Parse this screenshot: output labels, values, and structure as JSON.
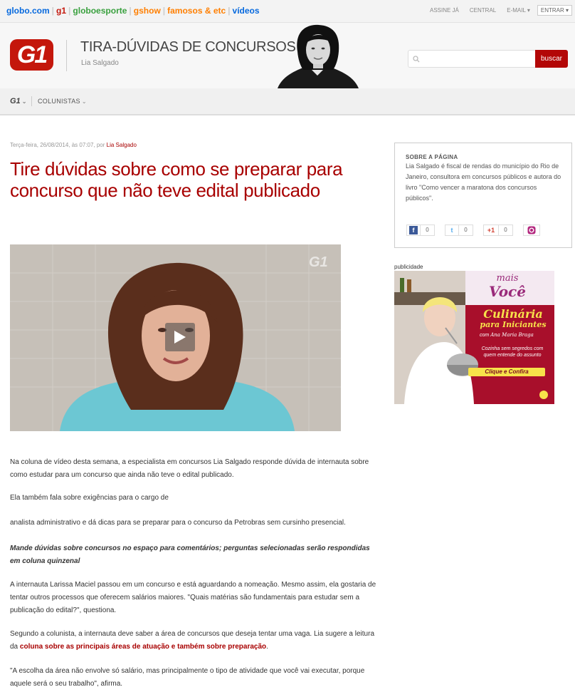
{
  "topbar": {
    "links": [
      {
        "label": "globo.com",
        "color": "#0669de"
      },
      {
        "label": "g1",
        "color": "#c4170c"
      },
      {
        "label": "globoesporte",
        "color": "#39a03e"
      },
      {
        "label": "gshow",
        "color": "#ff7f00"
      },
      {
        "label": "famosos & etc",
        "color": "#ff7f00"
      },
      {
        "label": "vídeos",
        "color": "#0669de"
      }
    ],
    "right": {
      "assine": "ASSINE JÁ",
      "central": "CENTRAL",
      "email": "E-MAIL",
      "entrar": "ENTRAR"
    }
  },
  "header": {
    "logo": "G1",
    "blog_title": "TIRA-DÚVIDAS DE CONCURSOS",
    "author": "Lia Salgado",
    "search_button": "buscar",
    "search_placeholder": ""
  },
  "nav": {
    "g1": "G1",
    "colunistas": "COLUNISTAS"
  },
  "article": {
    "meta_prefix": "Terça-feira, 26/08/2014, às 07:07, por",
    "meta_author": "Lia Salgado",
    "title": "Tire dúvidas sobre como se preparar para concurso que não teve edital publicado",
    "video_watermark": "G1",
    "paragraphs": [
      "Na coluna de vídeo desta semana, a especialista em concursos Lia Salgado responde dúvida de internauta sobre como estudar para um concurso que ainda não teve o edital publicado.",
      "Ela também fala sobre exigências para o cargo de",
      "analista administrativo e dá dicas para se preparar para o concurso da Petrobras sem cursinho presencial.",
      "Mande dúvidas sobre concursos no espaço para comentários; perguntas selecionadas serão respondidas em coluna quinzenal",
      "A internauta Larissa Maciel passou em um concurso e está aguardando a nomeação. Mesmo assim, ela gostaria de tentar outros processos que oferecem salários maiores. \"Quais matérias são fundamentais para estudar sem a publicação do edital?\", questiona."
    ],
    "p6_text": "Segundo a colunista, a internauta deve saber a área de concursos que deseja tentar uma vaga. Lia sugere a leitura da",
    "p6_link": "coluna sobre as principais áreas de atuação e também sobre preparação",
    "p6_end": ".",
    "p7": "\"A escolha da área não envolve só salário, mas principalmente o tipo de atividade que você vai executar, porque aquele será o seu trabalho\", afirma."
  },
  "sidebar": {
    "about_heading": "SOBRE A PÁGINA",
    "about_text": "Lia Salgado é fiscal de rendas do município do Rio de Janeiro, consultora em concursos públicos e autora do livro \"Como vencer a maratona dos concursos públicos\".",
    "shares": [
      {
        "icon": "facebook-icon",
        "glyph": "f",
        "count": "0",
        "color": "#3b5998"
      },
      {
        "icon": "twitter-icon",
        "glyph": "t",
        "count": "0",
        "color": "#55acee"
      },
      {
        "icon": "google-plus-icon",
        "glyph": "+1",
        "count": "0",
        "color": "#d23f31"
      }
    ],
    "ad_label": "publicidade",
    "ad": {
      "brand_top": "mais",
      "brand_bottom": "Você",
      "title_1": "Culinária",
      "title_2": "para Iniciantes",
      "with": "com",
      "signature": "Ana Maria Braga",
      "sub_1": "Cozinha sem segredos com",
      "sub_2": "quem entende do assunto",
      "cta": "Clique e Confira"
    }
  }
}
